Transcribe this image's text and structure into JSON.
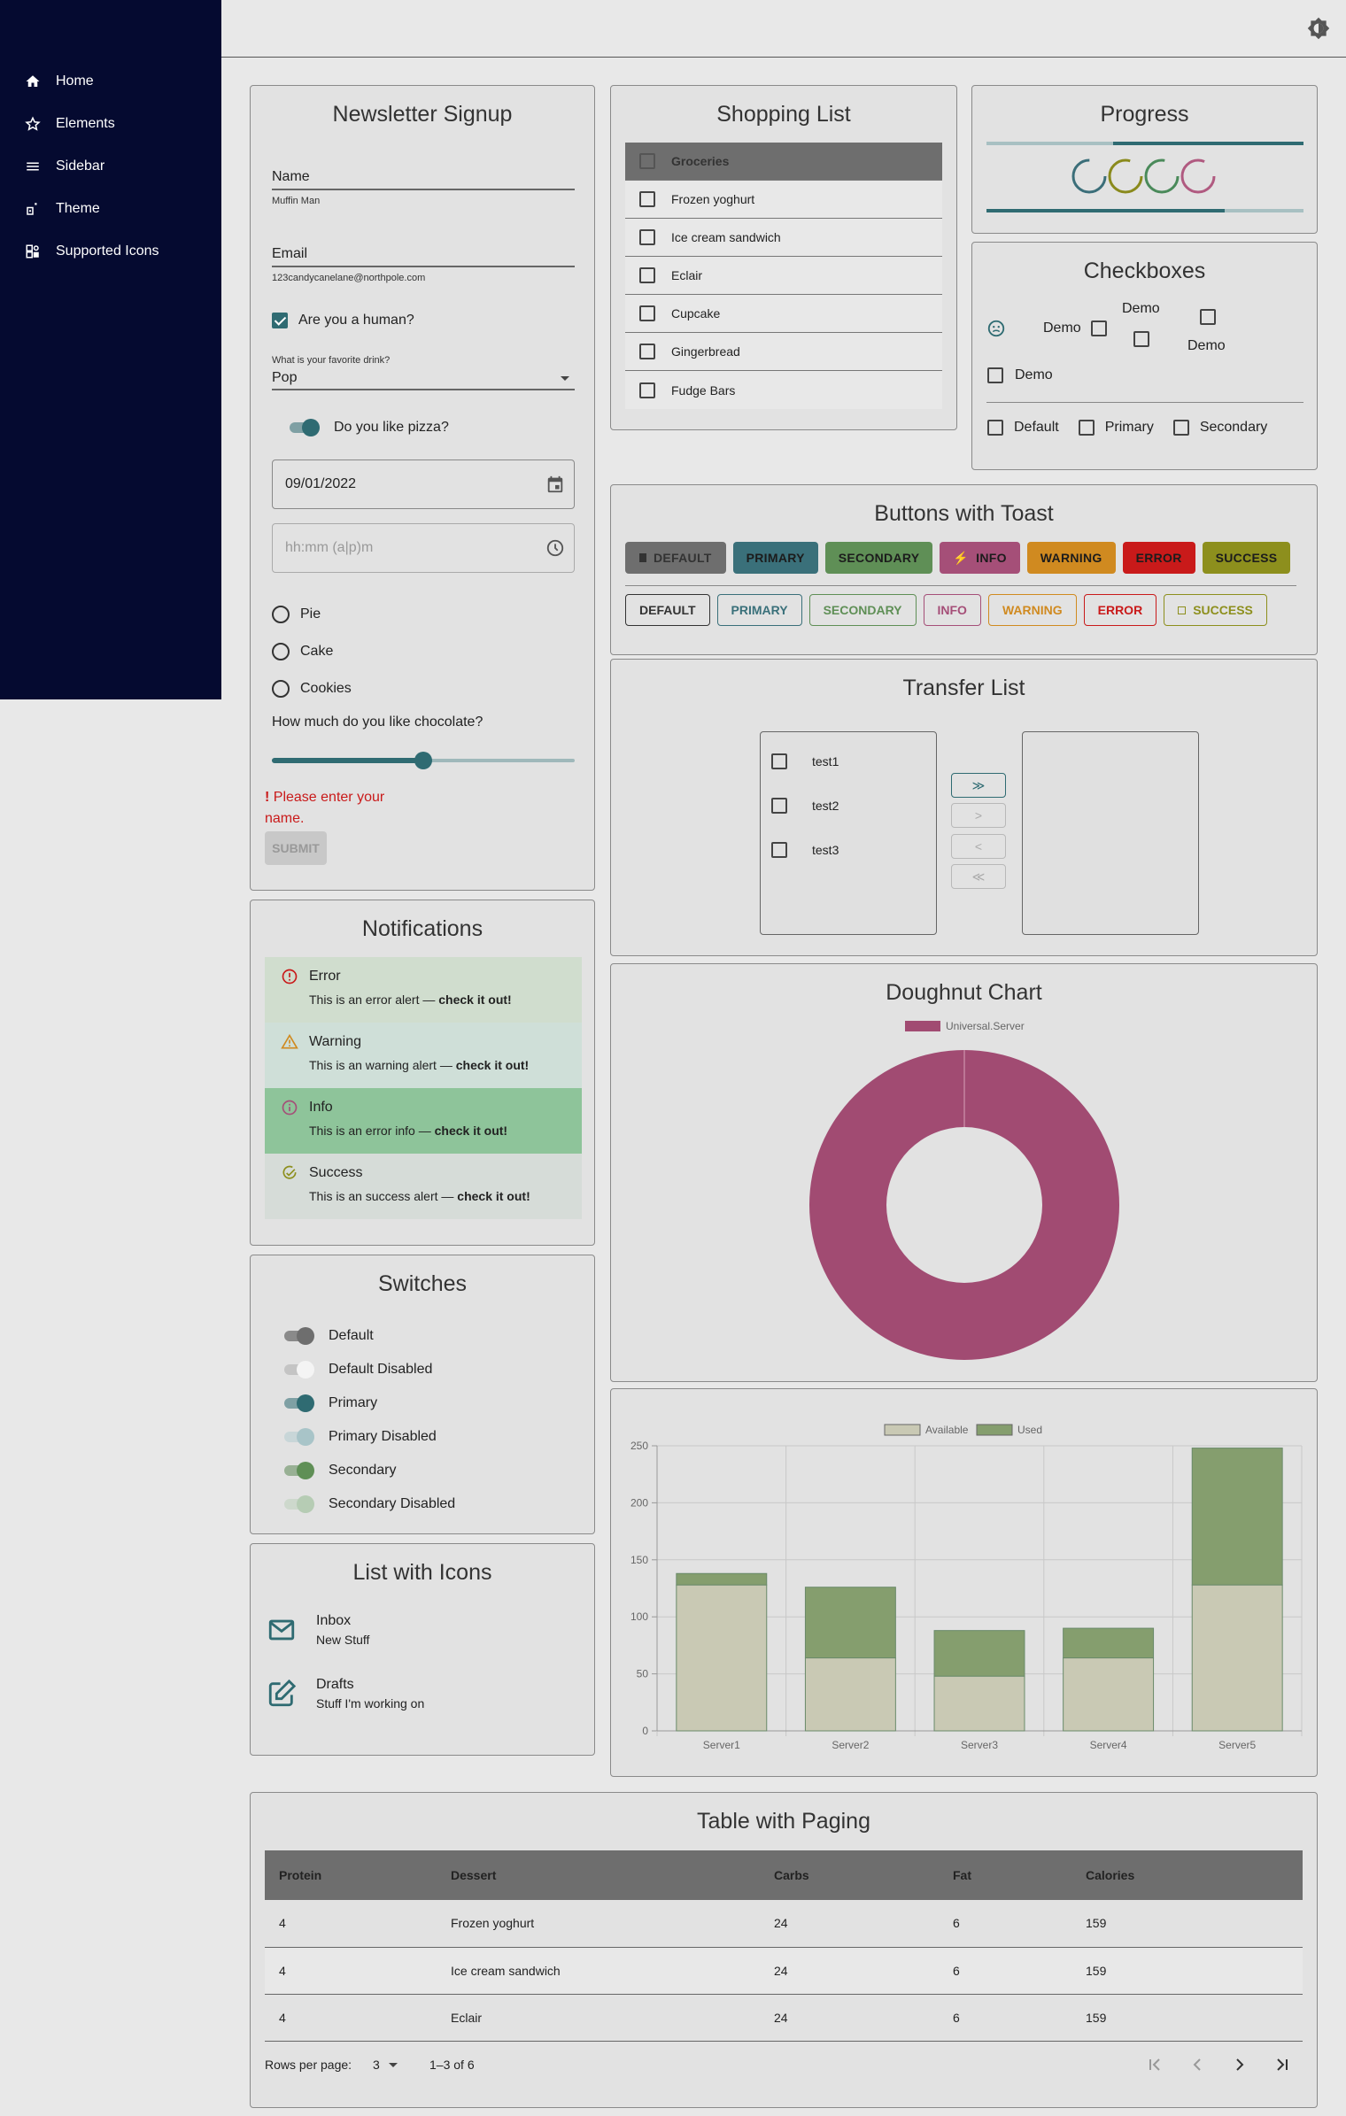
{
  "sidebar": {
    "items": [
      {
        "label": "Home",
        "icon": "home-icon"
      },
      {
        "label": "Elements",
        "icon": "star-icon"
      },
      {
        "label": "Sidebar",
        "icon": "menu-icon"
      },
      {
        "label": "Theme",
        "icon": "theme-icon"
      },
      {
        "label": "Supported Icons",
        "icon": "widgets-icon"
      }
    ]
  },
  "topbar": {
    "theme_icon": "brightness-icon"
  },
  "newsletter": {
    "title": "Newsletter Signup",
    "name_label": "Name",
    "name_value": "Muffin Man",
    "email_label": "Email",
    "email_value": "123candycanelane@northpole.com",
    "human_label": "Are you a human?",
    "human_checked": true,
    "drink_label": "What is your favorite drink?",
    "drink_value": "Pop",
    "pizza_label": "Do you like pizza?",
    "pizza_on": true,
    "date_value": "09/01/2022",
    "time_placeholder": "hh:mm (a|p)m",
    "radios": [
      "Pie",
      "Cake",
      "Cookies"
    ],
    "chocolate_label": "How much do you like chocolate?",
    "chocolate_level": 0.5,
    "error_text": "Please enter your name.",
    "error_mark": "!",
    "submit_label": "SUBMIT"
  },
  "shopping": {
    "title": "Shopping List",
    "header": "Groceries",
    "items": [
      "Frozen yoghurt",
      "Ice cream sandwich",
      "Eclair",
      "Cupcake",
      "Gingerbread",
      "Fudge Bars"
    ]
  },
  "progress": {
    "title": "Progress",
    "bar1_fraction": 0.6,
    "bar2_fraction": 0.75,
    "circle_colors": [
      "#3b6e79",
      "#8a8a1c",
      "#4a8a5a",
      "#b05a80"
    ]
  },
  "checkboxes": {
    "title": "Checkboxes",
    "demo": "Demo",
    "bottom": [
      "Default",
      "Primary",
      "Secondary"
    ]
  },
  "buttons": {
    "title": "Buttons with Toast",
    "filled": [
      {
        "label": "DEFAULT",
        "bg": "#6e6e6e",
        "fg": "#333"
      },
      {
        "label": "PRIMARY",
        "bg": "#3a707a",
        "fg": "#1c1c1c"
      },
      {
        "label": "SECONDARY",
        "bg": "#5f8f56",
        "fg": "#1c1c1c"
      },
      {
        "label": "INFO",
        "bg": "#a54f78",
        "fg": "#1c1c1c"
      },
      {
        "label": "WARNING",
        "bg": "#d08a20",
        "fg": "#1c1c1c"
      },
      {
        "label": "ERROR",
        "bg": "#c91a1a",
        "fg": "#1c1c1c"
      },
      {
        "label": "SUCCESS",
        "bg": "#8d8f1d",
        "fg": "#1c1c1c"
      }
    ],
    "outlined": [
      {
        "label": "DEFAULT",
        "color": "#333"
      },
      {
        "label": "PRIMARY",
        "color": "#3a707a"
      },
      {
        "label": "SECONDARY",
        "color": "#5f8f56"
      },
      {
        "label": "INFO",
        "color": "#a54f78"
      },
      {
        "label": "WARNING",
        "color": "#d08a20"
      },
      {
        "label": "ERROR",
        "color": "#c91a1a"
      },
      {
        "label": "SUCCESS",
        "color": "#8d8f1d"
      }
    ]
  },
  "transfer": {
    "title": "Transfer List",
    "left": [
      "test1",
      "test2",
      "test3"
    ],
    "buttons": [
      "≫",
      ">",
      "<",
      "≪"
    ]
  },
  "doughnut": {
    "title": "Doughnut Chart"
  },
  "notifications": {
    "title": "Notifications",
    "alerts": [
      {
        "title": "Error",
        "body": "This is an error alert — ",
        "strong": "check it out!",
        "bg": "#d0ddce",
        "icon": "error-icon"
      },
      {
        "title": "Warning",
        "body": "This is an warning alert — ",
        "strong": "check it out!",
        "bg": "#cfdfd8",
        "icon": "warning-icon"
      },
      {
        "title": "Info",
        "body": "This is an error info — ",
        "strong": "check it out!",
        "bg": "#8ec49a",
        "icon": "info-icon"
      },
      {
        "title": "Success",
        "body": "This is an success alert — ",
        "strong": "check it out!",
        "bg": "#d6dcd8",
        "icon": "check-circle-icon"
      }
    ]
  },
  "switches": {
    "title": "Switches",
    "items": [
      {
        "label": "Default",
        "track": "#8a8a8a",
        "thumb": "#6e6e6e"
      },
      {
        "label": "Default Disabled",
        "track": "#c4c4c4",
        "thumb": "#f4f4f4"
      },
      {
        "label": "Primary",
        "track": "#7fa0a4",
        "thumb": "#2f6b72"
      },
      {
        "label": "Primary Disabled",
        "track": "#c8d6d8",
        "thumb": "#a8c4c8"
      },
      {
        "label": "Secondary",
        "track": "#98b094",
        "thumb": "#5f8f56"
      },
      {
        "label": "Secondary Disabled",
        "track": "#cdd8cc",
        "thumb": "#b6ccb4"
      }
    ]
  },
  "icon_list": {
    "title": "List with Icons",
    "items": [
      {
        "primary": "Inbox",
        "secondary": "New Stuff",
        "icon": "mail-icon"
      },
      {
        "primary": "Drafts",
        "secondary": "Stuff I'm working on",
        "icon": "edit-icon"
      }
    ]
  },
  "table": {
    "title": "Table with Paging",
    "columns": [
      "Protein",
      "Dessert",
      "Carbs",
      "Fat",
      "Calories"
    ],
    "rows": [
      [
        "4",
        "Frozen yoghurt",
        "24",
        "6",
        "159"
      ],
      [
        "4",
        "Ice cream sandwich",
        "24",
        "6",
        "159"
      ],
      [
        "4",
        "Eclair",
        "24",
        "6",
        "159"
      ]
    ],
    "rows_per_page_label": "Rows per page:",
    "rows_per_page": "3",
    "range": "1–3 of 6"
  },
  "chart_data": [
    {
      "type": "pie",
      "title": "",
      "series": [
        {
          "name": "Universal.Server",
          "values": [
            100
          ]
        }
      ],
      "color": "#a14b72",
      "hole": true,
      "legend": "top"
    },
    {
      "type": "bar",
      "stacked": true,
      "categories": [
        "Server1",
        "Server2",
        "Server3",
        "Server4",
        "Server5"
      ],
      "series": [
        {
          "name": "Available",
          "values": [
            128,
            64,
            48,
            64,
            128
          ],
          "color": "#c9c9b4"
        },
        {
          "name": "Used",
          "values": [
            10,
            62,
            40,
            26,
            120
          ],
          "color": "#859e6e"
        }
      ],
      "ylim": [
        0,
        250
      ],
      "yticks": [
        "0",
        "50",
        "100",
        "150",
        "200",
        "250"
      ],
      "grid": true,
      "legend": "top"
    }
  ]
}
